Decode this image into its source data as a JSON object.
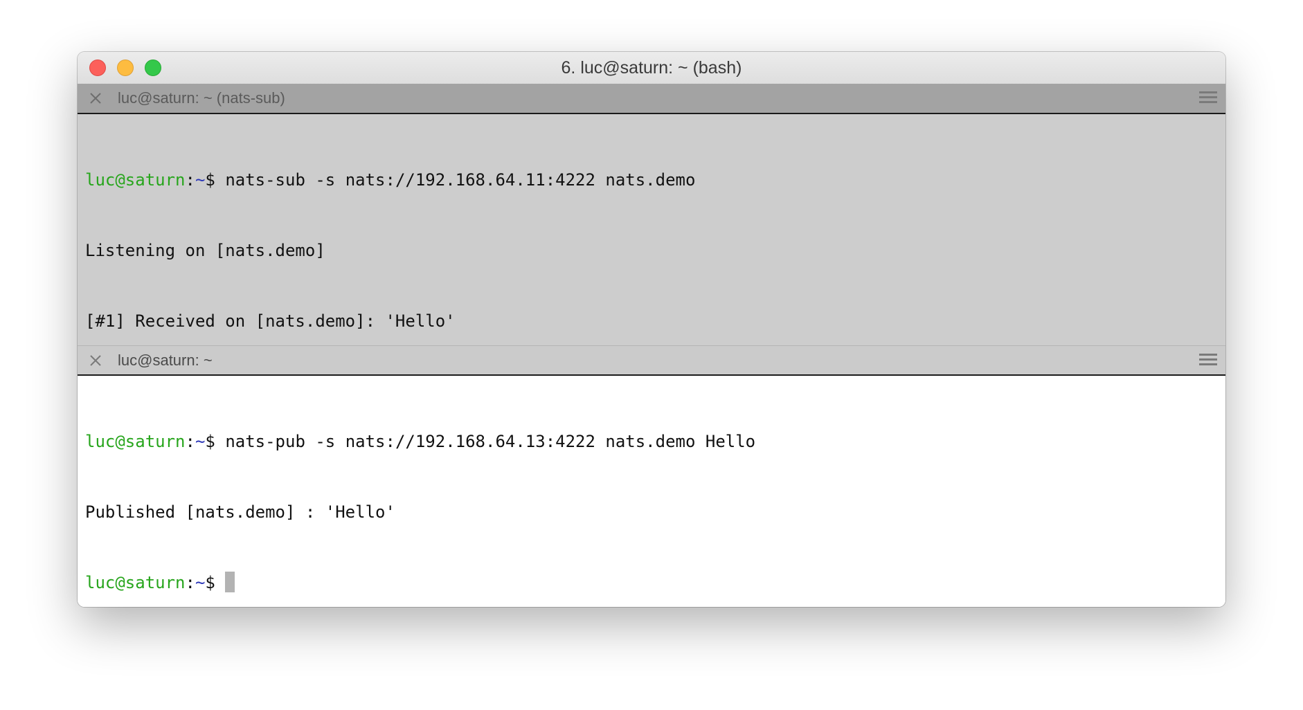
{
  "window": {
    "title": "6. luc@saturn: ~ (bash)"
  },
  "panes": {
    "top": {
      "tab_title": "luc@saturn: ~ (nats-sub)",
      "lines": [
        {
          "user": "luc@saturn",
          "sep": ":",
          "path": "~",
          "prompt_end": "$ ",
          "command": "nats-sub -s nats://192.168.64.11:4222 nats.demo"
        },
        {
          "text": "Listening on [nats.demo]"
        },
        {
          "text": "[#1] Received on [nats.demo]: 'Hello'"
        }
      ]
    },
    "bottom": {
      "tab_title": "luc@saturn: ~",
      "lines": [
        {
          "user": "luc@saturn",
          "sep": ":",
          "path": "~",
          "prompt_end": "$ ",
          "command": "nats-pub -s nats://192.168.64.13:4222 nats.demo Hello"
        },
        {
          "text": "Published [nats.demo] : 'Hello'"
        },
        {
          "user": "luc@saturn",
          "sep": ":",
          "path": "~",
          "prompt_end": "$",
          "command": ""
        }
      ]
    }
  },
  "icons": {
    "close_traffic": "close-window-icon",
    "minimize_traffic": "minimize-window-icon",
    "zoom_traffic": "zoom-window-icon",
    "pane_close": "close-pane-icon",
    "pane_menu": "hamburger-menu-icon"
  },
  "colors": {
    "prompt_user": "#27a51c",
    "prompt_path": "#2b36b8",
    "inactive_pane_bg": "#cdcdcd",
    "active_pane_bg": "#ffffff"
  }
}
